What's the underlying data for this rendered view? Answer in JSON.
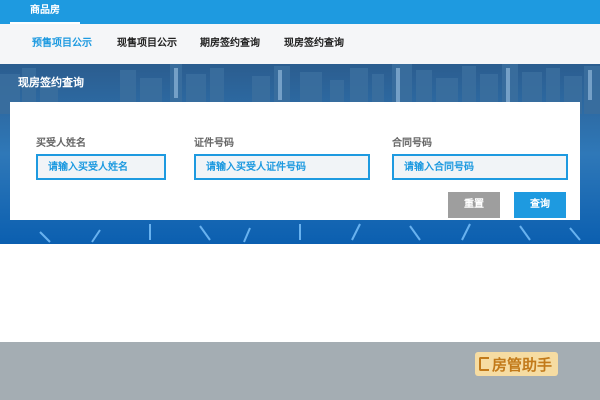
{
  "top_tab": {
    "label": "商品房"
  },
  "nav": {
    "items": [
      {
        "label": "预售项目公示",
        "active": true
      },
      {
        "label": "现售项目公示",
        "active": false
      },
      {
        "label": "期房签约查询",
        "active": false
      },
      {
        "label": "现房签约查询",
        "active": false
      }
    ]
  },
  "hero": {
    "title": "现房签约查询"
  },
  "form": {
    "buyer_name": {
      "label": "买受人姓名",
      "placeholder": "请输入买受人姓名"
    },
    "id_number": {
      "label": "证件号码",
      "placeholder": "请输入买受人证件号码"
    },
    "contract_no": {
      "label": "合同号码",
      "placeholder": "请输入合同号码"
    }
  },
  "buttons": {
    "reset": "重置",
    "query": "查询"
  },
  "watermark": {
    "text": "房管助手"
  },
  "colors": {
    "accent": "#1e9ae0",
    "reset_button": "#9e9e9e",
    "footer": "#a4adb3"
  }
}
